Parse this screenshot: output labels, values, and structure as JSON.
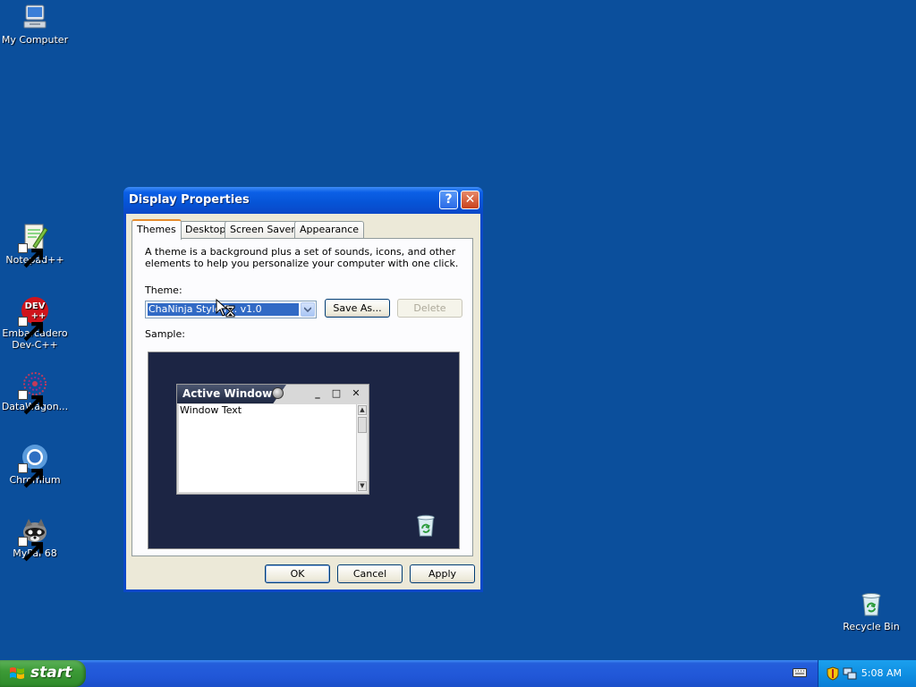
{
  "desktop": {
    "icons": [
      {
        "label": "My Computer"
      },
      {
        "label": "Notepad++"
      },
      {
        "label": "Embarcadero Dev-C++"
      },
      {
        "label": "DataWagon..."
      },
      {
        "label": "Chromium"
      },
      {
        "label": "MyPal 68"
      },
      {
        "label": "Recycle Bin"
      }
    ]
  },
  "window": {
    "title": "Display Properties",
    "help_glyph": "?",
    "close_glyph": "✕",
    "tabs": [
      {
        "label": "Themes",
        "active": true
      },
      {
        "label": "Desktop",
        "active": false
      },
      {
        "label": "Screen Saver",
        "active": false
      },
      {
        "label": "Appearance",
        "active": false
      }
    ],
    "description": "A theme is a background plus a set of sounds, icons, and other elements to help you personalize your computer with one click.",
    "theme_label": "Theme:",
    "theme_value": "ChaNinja Style F... v1.0",
    "save_as_label": "Save As...",
    "delete_label": "Delete",
    "sample_label": "Sample:",
    "sample": {
      "window_title": "Active Window",
      "window_text": "Window Text",
      "min_glyph": "_",
      "max_glyph": "□",
      "close_glyph": "✕"
    },
    "ok_label": "OK",
    "cancel_label": "Cancel",
    "apply_label": "Apply"
  },
  "taskbar": {
    "start_label": "start",
    "clock": "5:08 AM"
  },
  "colors": {
    "desktop": "#0b4f9c",
    "titlebar": "#0654d6",
    "taskbar": "#245edb",
    "start": "#3c9a36",
    "selection": "#316ac5"
  }
}
